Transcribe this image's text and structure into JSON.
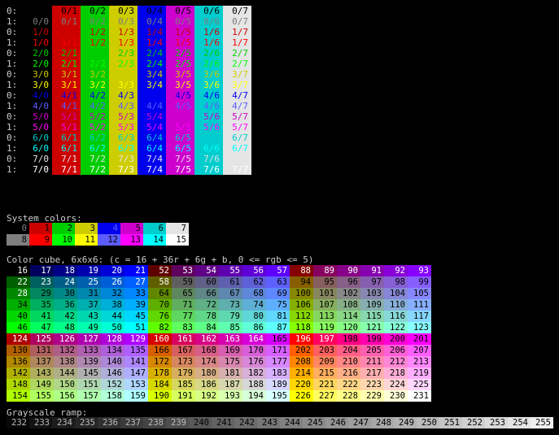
{
  "palette": {
    "normal": [
      "#000000",
      "#cd0000",
      "#00cd00",
      "#cdcd00",
      "#0000ee",
      "#cd00cd",
      "#00cdcd",
      "#e5e5e5"
    ],
    "bright": [
      "#7f7f7f",
      "#ff0000",
      "#00ff00",
      "#ffff00",
      "#5c5cff",
      "#ff00ff",
      "#00ffff",
      "#ffffff"
    ],
    "bold_fg": [
      "#7f7f7f",
      "#ff0000",
      "#00ff00",
      "#ffff00",
      "#5c5cff",
      "#ff00ff",
      "#00ffff",
      "#ffffff"
    ]
  },
  "matrix": {
    "rows": [
      {
        "label": "0:",
        "fg": 0,
        "bold": false
      },
      {
        "label": "1:",
        "fg": 0,
        "bold": true
      },
      {
        "label": "0:",
        "fg": 1,
        "bold": false
      },
      {
        "label": "1:",
        "fg": 1,
        "bold": true
      },
      {
        "label": "0:",
        "fg": 2,
        "bold": false
      },
      {
        "label": "1:",
        "fg": 2,
        "bold": true
      },
      {
        "label": "0:",
        "fg": 3,
        "bold": false
      },
      {
        "label": "1:",
        "fg": 3,
        "bold": true
      },
      {
        "label": "0:",
        "fg": 4,
        "bold": false
      },
      {
        "label": "1:",
        "fg": 4,
        "bold": true
      },
      {
        "label": "0:",
        "fg": 5,
        "bold": false
      },
      {
        "label": "1:",
        "fg": 5,
        "bold": true
      },
      {
        "label": "0:",
        "fg": 6,
        "bold": false
      },
      {
        "label": "1:",
        "fg": 6,
        "bold": true
      },
      {
        "label": "0:",
        "fg": 7,
        "bold": false
      },
      {
        "label": "1:",
        "fg": 7,
        "bold": true
      }
    ],
    "columns": [
      {
        "bg": null,
        "text_suffix": "0"
      },
      {
        "bg": 1,
        "text_suffix": "1"
      },
      {
        "bg": 2,
        "text_suffix": "2"
      },
      {
        "bg": 3,
        "text_suffix": "3"
      },
      {
        "bg": 4,
        "text_suffix": "4"
      },
      {
        "bg": 5,
        "text_suffix": "5"
      },
      {
        "bg": 6,
        "text_suffix": "6"
      },
      {
        "bg": 7,
        "text_suffix": "7"
      }
    ],
    "first_col_prefix": "0/0",
    "first_col_prefix_row": "1/0"
  },
  "system_colors": {
    "title": "System colors:",
    "normal_labels": [
      "0",
      "1",
      "2",
      "3",
      "4",
      "5",
      "6",
      "7"
    ],
    "bright_labels": [
      "8",
      "9",
      "10",
      "11",
      "12",
      "13",
      "14",
      "15"
    ]
  },
  "color_cube": {
    "title": "Color cube, 6x6x6: (c = 16 + 36r + 6g + b, 0 <= rgb <= 5)"
  },
  "grayscale": {
    "title": "Grayscale ramp:",
    "labels": [
      "232",
      "233",
      "234",
      "235",
      "236",
      "237",
      "238",
      "239",
      "240",
      "241",
      "242",
      "243",
      "244",
      "245",
      "246",
      "247",
      "248",
      "249",
      "250",
      "251",
      "252",
      "253",
      "254",
      "255"
    ]
  }
}
